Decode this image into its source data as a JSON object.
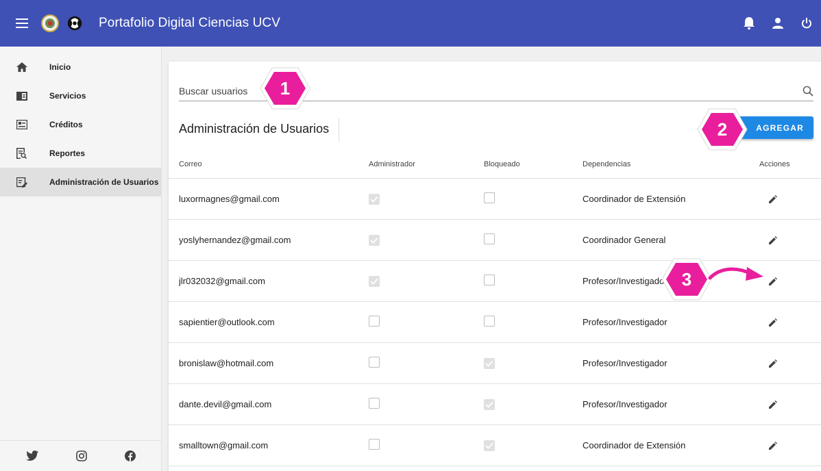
{
  "app": {
    "title": "Portafolio Digital Ciencias UCV"
  },
  "header": {
    "icons": [
      "menu-icon",
      "bell-icon",
      "user-icon",
      "power-icon"
    ]
  },
  "sidebar": {
    "items": [
      {
        "label": "Inicio",
        "icon": "home-icon"
      },
      {
        "label": "Servicios",
        "icon": "services-icon"
      },
      {
        "label": "Créditos",
        "icon": "credits-icon"
      },
      {
        "label": "Reportes",
        "icon": "reports-icon"
      },
      {
        "label": "Administración de Usuarios",
        "icon": "user-admin-icon",
        "active": true
      }
    ],
    "social": [
      "twitter-icon",
      "instagram-icon",
      "facebook-icon"
    ]
  },
  "search": {
    "placeholder": "Buscar usuarios"
  },
  "section": {
    "title": "Administración de Usuarios",
    "add_label": "AGREGAR"
  },
  "table": {
    "headers": {
      "email": "Correo",
      "admin": "Administrador",
      "blocked": "Bloqueado",
      "deps": "Dependencias",
      "actions": "Acciones"
    },
    "rows": [
      {
        "email": "luxormagnes@gmail.com",
        "admin": true,
        "blocked": false,
        "dep": "Coordinador de Extensión"
      },
      {
        "email": "yoslyhernandez@gmail.com",
        "admin": true,
        "blocked": false,
        "dep": "Coordinador General"
      },
      {
        "email": "jlr032032@gmail.com",
        "admin": true,
        "blocked": false,
        "dep": "Profesor/Investigador"
      },
      {
        "email": "sapientier@outlook.com",
        "admin": false,
        "blocked": false,
        "dep": "Profesor/Investigador"
      },
      {
        "email": "bronislaw@hotmail.com",
        "admin": false,
        "blocked": true,
        "dep": "Profesor/Investigador"
      },
      {
        "email": "dante.devil@gmail.com",
        "admin": false,
        "blocked": true,
        "dep": "Profesor/Investigador"
      },
      {
        "email": "smalltown@gmail.com",
        "admin": false,
        "blocked": true,
        "dep": "Coordinador de Extensión"
      }
    ]
  },
  "callouts": [
    "1",
    "2",
    "3"
  ],
  "colors": {
    "header": "#3f51b5",
    "accent": "#1e88e5",
    "callout": "#e91e9c"
  }
}
